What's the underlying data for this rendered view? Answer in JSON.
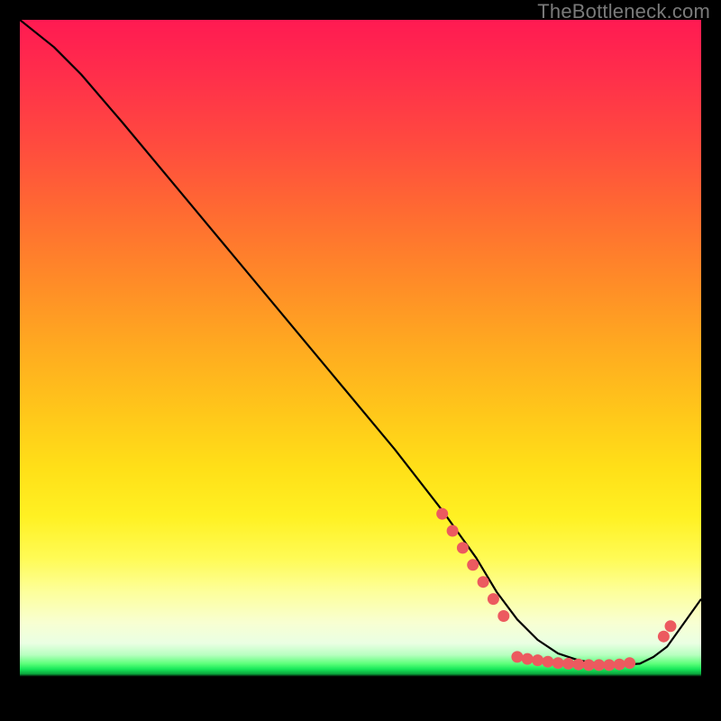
{
  "watermark": "TheBottleneck.com",
  "chart_data": {
    "type": "line",
    "title": "",
    "xlabel": "",
    "ylabel": "",
    "xlim": [
      0,
      100
    ],
    "ylim": [
      0,
      100
    ],
    "series": [
      {
        "name": "bottleneck-curve",
        "x": [
          0,
          5,
          9,
          15,
          25,
          35,
          45,
          55,
          62,
          67,
          70,
          73,
          76,
          79,
          82,
          85,
          88,
          91,
          93,
          95,
          100
        ],
        "y": [
          100,
          96,
          92,
          85,
          73,
          61,
          49,
          37,
          28,
          21,
          16,
          12,
          9,
          7,
          6,
          5.5,
          5.3,
          5.5,
          6.5,
          8,
          15
        ]
      }
    ],
    "markers": [
      {
        "x": 62.0,
        "y": 27.5
      },
      {
        "x": 63.5,
        "y": 25.0
      },
      {
        "x": 65.0,
        "y": 22.5
      },
      {
        "x": 66.5,
        "y": 20.0
      },
      {
        "x": 68.0,
        "y": 17.5
      },
      {
        "x": 69.5,
        "y": 15.0
      },
      {
        "x": 71.0,
        "y": 12.5
      },
      {
        "x": 73.0,
        "y": 6.5
      },
      {
        "x": 74.5,
        "y": 6.2
      },
      {
        "x": 76.0,
        "y": 6.0
      },
      {
        "x": 77.5,
        "y": 5.8
      },
      {
        "x": 79.0,
        "y": 5.6
      },
      {
        "x": 80.5,
        "y": 5.5
      },
      {
        "x": 82.0,
        "y": 5.4
      },
      {
        "x": 83.5,
        "y": 5.3
      },
      {
        "x": 85.0,
        "y": 5.3
      },
      {
        "x": 86.5,
        "y": 5.3
      },
      {
        "x": 88.0,
        "y": 5.4
      },
      {
        "x": 89.5,
        "y": 5.6
      },
      {
        "x": 94.5,
        "y": 9.5
      },
      {
        "x": 95.5,
        "y": 11.0
      }
    ],
    "marker_color": "#ec5a5f",
    "curve_color": "#000000"
  }
}
